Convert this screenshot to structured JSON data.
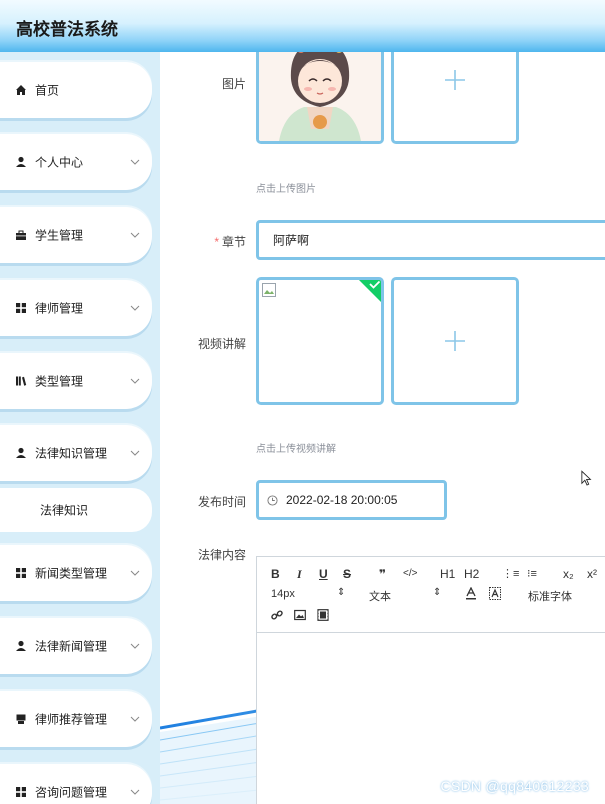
{
  "header": {
    "title": "高校普法系统"
  },
  "sidebar": {
    "items": [
      {
        "label": "首页",
        "icon": "home-icon",
        "has_arrow": false
      },
      {
        "label": "个人中心",
        "icon": "user-icon",
        "has_arrow": true
      },
      {
        "label": "学生管理",
        "icon": "briefcase-icon",
        "has_arrow": true
      },
      {
        "label": "律师管理",
        "icon": "grid-icon",
        "has_arrow": true
      },
      {
        "label": "类型管理",
        "icon": "books-icon",
        "has_arrow": true
      },
      {
        "label": "法律知识管理",
        "icon": "user-icon",
        "has_arrow": true
      },
      {
        "label": "法律知识",
        "icon": "",
        "has_arrow": false
      },
      {
        "label": "新闻类型管理",
        "icon": "grid-icon",
        "has_arrow": true
      },
      {
        "label": "法律新闻管理",
        "icon": "user-icon",
        "has_arrow": true
      },
      {
        "label": "律师推荐管理",
        "icon": "print-icon",
        "has_arrow": true
      },
      {
        "label": "咨询问题管理",
        "icon": "grid-icon",
        "has_arrow": true
      }
    ]
  },
  "form": {
    "image_label": "图片",
    "image_tip": "点击上传图片",
    "chapter_label": "章节",
    "chapter_required": "*",
    "chapter_value": "阿萨啊",
    "video_label": "视频讲解",
    "video_tip": "点击上传视频讲解",
    "time_label": "发布时间",
    "time_value": "2022-02-18 20:00:05",
    "content_label": "法律内容"
  },
  "editor": {
    "bold": "B",
    "italic": "I",
    "underline": "U",
    "strike": "S",
    "quote": "❞",
    "code": "</>",
    "h1": "H1",
    "h2": "H2",
    "ordered_list": "⋮≡",
    "bullet_list": "⁝≡",
    "sub": "x₂",
    "sup": "x²",
    "font_size": "14px",
    "text_style": "文本",
    "font_family": "标准字体"
  },
  "watermark": "CSDN @qq840612233",
  "colors": {
    "accent": "#7fc4e8",
    "success": "#13ce66",
    "header_grad_end": "#4fb6ee",
    "sidebar_bg": "#d8eef9"
  }
}
